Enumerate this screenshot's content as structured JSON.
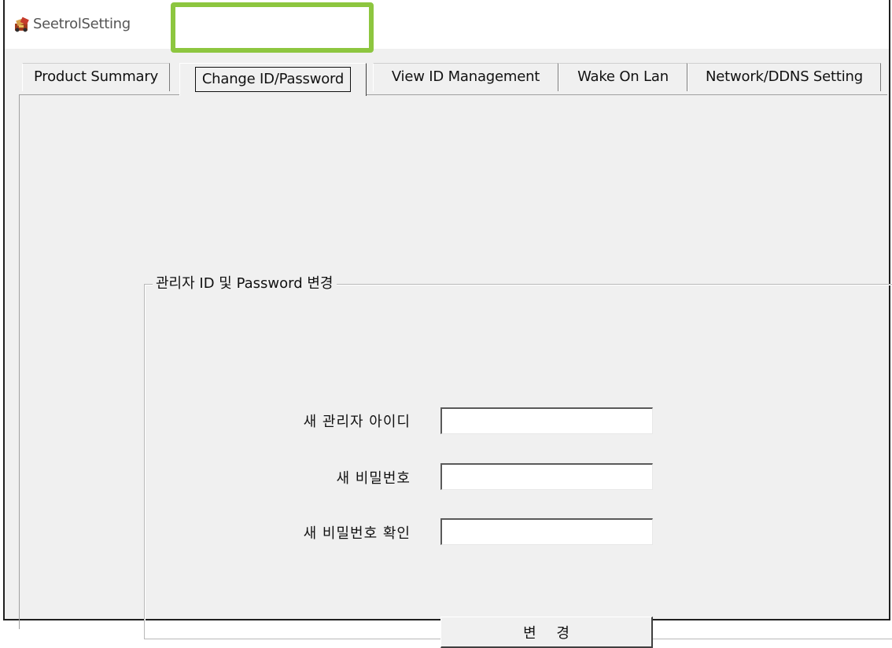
{
  "window": {
    "title": "SeetrolSetting",
    "icon": "seetrol-app-icon"
  },
  "tabs": [
    {
      "label": "Product Summary",
      "selected": false
    },
    {
      "label": "Change ID/Password",
      "selected": true
    },
    {
      "label": "View ID Management",
      "selected": false
    },
    {
      "label": "Wake On Lan",
      "selected": false
    },
    {
      "label": "Network/DDNS Setting",
      "selected": false
    }
  ],
  "highlight": {
    "color": "#8dc63f",
    "target": "Change ID/Password"
  },
  "group": {
    "title": "관리자 ID 및 Password 변경",
    "fields": [
      {
        "label": "새 관리자 아이디",
        "value": ""
      },
      {
        "label": "새 비밀번호",
        "value": ""
      },
      {
        "label": "새 비밀번호 확인",
        "value": ""
      }
    ],
    "button_label": "변 경"
  }
}
